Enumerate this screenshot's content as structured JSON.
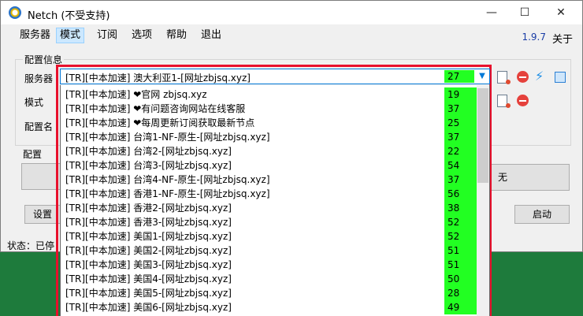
{
  "window": {
    "title": "Netch (不受支持)",
    "controls": {
      "minimize": "—",
      "maximize": "☐",
      "close": "✕"
    }
  },
  "menu": {
    "items": [
      "服务器",
      "模式",
      "订阅",
      "选项",
      "帮助",
      "退出"
    ],
    "active": "模式",
    "version": "1.9.7",
    "about": "关于"
  },
  "config": {
    "group_label": "配置信息",
    "server_label": "服务器",
    "mode_label": "模式",
    "profile_label": "配置名",
    "profile_group_label": "配置"
  },
  "buttons": {
    "none_label": "无",
    "settings_label": "设置",
    "start_label": "启动"
  },
  "status": {
    "text": "状态：已停"
  },
  "selected_server": {
    "name": "[TR][中本加速] 澳大利亚1-[网址zbjsq.xyz]",
    "delay": "27"
  },
  "servers": [
    {
      "name": "[TR][中本加速] ❤官网 zbjsq.xyz",
      "delay": "19"
    },
    {
      "name": "[TR][中本加速] ❤有问题咨询网站在线客服",
      "delay": "37"
    },
    {
      "name": "[TR][中本加速] ❤每周更新订阅获取最新节点",
      "delay": "25"
    },
    {
      "name": "[TR][中本加速] 台湾1-NF-原生-[网址zbjsq.xyz]",
      "delay": "37"
    },
    {
      "name": "[TR][中本加速] 台湾2-[网址zbjsq.xyz]",
      "delay": "22"
    },
    {
      "name": "[TR][中本加速] 台湾3-[网址zbjsq.xyz]",
      "delay": "54"
    },
    {
      "name": "[TR][中本加速] 台湾4-NF-原生-[网址zbjsq.xyz]",
      "delay": "37"
    },
    {
      "name": "[TR][中本加速] 香港1-NF-原生-[网址zbjsq.xyz]",
      "delay": "56"
    },
    {
      "name": "[TR][中本加速] 香港2-[网址zbjsq.xyz]",
      "delay": "38"
    },
    {
      "name": "[TR][中本加速] 香港3-[网址zbjsq.xyz]",
      "delay": "52"
    },
    {
      "name": "[TR][中本加速] 美国1-[网址zbjsq.xyz]",
      "delay": "52"
    },
    {
      "name": "[TR][中本加速] 美国2-[网址zbjsq.xyz]",
      "delay": "51"
    },
    {
      "name": "[TR][中本加速] 美国3-[网址zbjsq.xyz]",
      "delay": "51"
    },
    {
      "name": "[TR][中本加速] 美国4-[网址zbjsq.xyz]",
      "delay": "50"
    },
    {
      "name": "[TR][中本加速] 美国5-[网址zbjsq.xyz]",
      "delay": "28"
    },
    {
      "name": "[TR][中本加速] 美国6-[网址zbjsq.xyz]",
      "delay": "49"
    }
  ],
  "colors": {
    "delay_bg": "#22ff22",
    "highlight_frame": "#e8102c",
    "version": "#1a3da6",
    "desktop": "#1e7b3c"
  },
  "icons": [
    "app-icon",
    "add-document-icon",
    "remove-icon",
    "lightning-icon",
    "copy-icon",
    "chevron-down-icon"
  ]
}
